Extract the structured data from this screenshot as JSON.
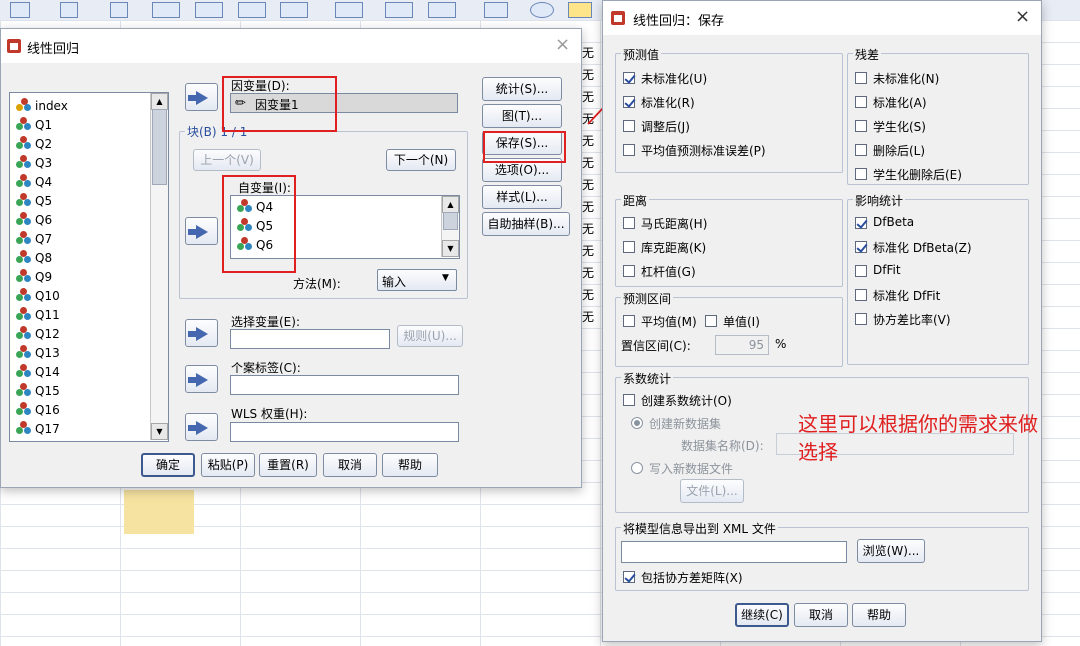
{
  "background": {
    "column_char": "无",
    "column_rows": 13
  },
  "regression_dialog": {
    "title": "线性回归",
    "close_label": "×",
    "variables": [
      {
        "name": "index",
        "kind": "ruler"
      },
      {
        "name": "Q1",
        "kind": "nominal"
      },
      {
        "name": "Q2",
        "kind": "nominal"
      },
      {
        "name": "Q3",
        "kind": "nominal"
      },
      {
        "name": "Q4",
        "kind": "nominal"
      },
      {
        "name": "Q5",
        "kind": "nominal"
      },
      {
        "name": "Q6",
        "kind": "nominal"
      },
      {
        "name": "Q7",
        "kind": "nominal"
      },
      {
        "name": "Q8",
        "kind": "nominal"
      },
      {
        "name": "Q9",
        "kind": "nominal"
      },
      {
        "name": "Q10",
        "kind": "nominal"
      },
      {
        "name": "Q11",
        "kind": "nominal"
      },
      {
        "name": "Q12",
        "kind": "nominal"
      },
      {
        "name": "Q13",
        "kind": "nominal"
      },
      {
        "name": "Q14",
        "kind": "nominal"
      },
      {
        "name": "Q15",
        "kind": "nominal"
      },
      {
        "name": "Q16",
        "kind": "nominal"
      },
      {
        "name": "Q17",
        "kind": "nominal"
      }
    ],
    "dependent_label": "因变量(D):",
    "dependent_value": "因变量1",
    "block_label": "块(B) 1 / 1",
    "prev_label": "上一个(V)",
    "next_label": "下一个(N)",
    "independent_label": "自变量(I):",
    "independents": [
      "Q4",
      "Q5",
      "Q6"
    ],
    "method_label": "方法(M):",
    "method_value": "输入",
    "selection_label": "选择变量(E):",
    "rule_label": "规则(U)...",
    "case_label": "个案标签(C):",
    "wls_label": "WLS 权重(H):",
    "side_buttons": [
      "统计(S)...",
      "图(T)...",
      "保存(S)...",
      "选项(O)...",
      "样式(L)...",
      "自助抽样(B)..."
    ],
    "bottom_buttons": [
      "确定",
      "粘贴(P)",
      "重置(R)",
      "取消",
      "帮助"
    ]
  },
  "save_dialog": {
    "title": "线性回归：保存",
    "close_label": "×",
    "predicted": {
      "title": "预测值",
      "items": [
        {
          "label": "未标准化(U)",
          "checked": true
        },
        {
          "label": "标准化(R)",
          "checked": true
        },
        {
          "label": "调整后(J)",
          "checked": false
        },
        {
          "label": "平均值预测标准误差(P)",
          "checked": false
        }
      ]
    },
    "residuals": {
      "title": "残差",
      "items": [
        {
          "label": "未标准化(N)",
          "checked": false
        },
        {
          "label": "标准化(A)",
          "checked": false
        },
        {
          "label": "学生化(S)",
          "checked": false
        },
        {
          "label": "删除后(L)",
          "checked": false
        },
        {
          "label": "学生化删除后(E)",
          "checked": false
        }
      ]
    },
    "distances": {
      "title": "距离",
      "items": [
        {
          "label": "马氏距离(H)",
          "checked": false
        },
        {
          "label": "库克距离(K)",
          "checked": false
        },
        {
          "label": "杠杆值(G)",
          "checked": false
        }
      ]
    },
    "influence": {
      "title": "影响统计",
      "items": [
        {
          "label": "DfBeta",
          "checked": true
        },
        {
          "label": "标准化 DfBeta(Z)",
          "checked": true
        },
        {
          "label": "DfFit",
          "checked": false
        },
        {
          "label": "标准化 DfFit",
          "checked": false
        },
        {
          "label": "协方差比率(V)",
          "checked": false
        }
      ]
    },
    "intervals": {
      "title": "预测区间",
      "mean_label": "平均值(M)",
      "individual_label": "单值(I)",
      "confidence_label": "置信区间(C):",
      "confidence_value": "95",
      "percent": "%"
    },
    "coef": {
      "title": "系数统计",
      "create_label": "创建系数统计(O)",
      "new_dataset_label": "创建新数据集",
      "dataset_name_label": "数据集名称(D):",
      "write_file_label": "写入新数据文件",
      "file_button": "文件(L)..."
    },
    "export": {
      "title": "将模型信息导出到 XML 文件",
      "browse_label": "浏览(W)...",
      "include_label": "包括协方差矩阵(X)",
      "include_checked": true
    },
    "buttons": [
      "继续(C)",
      "取消",
      "帮助"
    ]
  },
  "annotation": {
    "text_line1": "这里可以根据你的需求来做",
    "text_line2": "选择"
  },
  "colors": {
    "annotation_red": "#e02020",
    "check_blue": "#2a4e9e",
    "arrow_blue": "#4467b0"
  }
}
